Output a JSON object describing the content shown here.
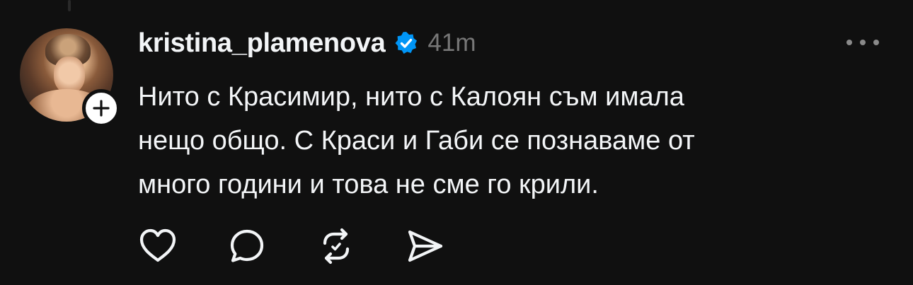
{
  "post": {
    "author": "kristina_plamenova",
    "verified": true,
    "time": "41m",
    "text_lines": [
      "Нито с Красимир, нито с Калоян съм имала",
      "нещо общо. С Краси и Габи се познаваме от",
      "много години и това не сме го крили."
    ]
  },
  "icons": {
    "follow": "plus-icon",
    "verified": "verified-badge-icon",
    "more": "more-horizontal-icon",
    "like": "heart-icon",
    "reply": "comment-icon",
    "repost": "repost-icon",
    "share": "send-icon"
  },
  "colors": {
    "background": "#101010",
    "text": "#f3f5f7",
    "muted": "#777777",
    "verified": "#0095f6"
  }
}
